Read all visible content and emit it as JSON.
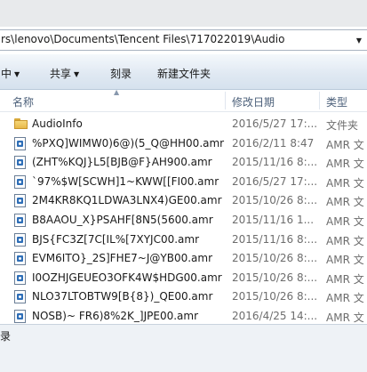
{
  "address": {
    "path": "rs\\lenovo\\Documents\\Tencent Files\\717022019\\Audio",
    "dropdown_icon": "chevron-down-icon"
  },
  "toolbar": {
    "organize_fragment": "中",
    "share_label": "共享",
    "burn_label": "刻录",
    "new_folder_label": "新建文件夹"
  },
  "columns": {
    "name": "名称",
    "date": "修改日期",
    "type": "类型"
  },
  "files": [
    {
      "name": "AudioInfo",
      "date": "2016/5/27 17:...",
      "type": "文件夹",
      "icon": "folder-icon"
    },
    {
      "name": "%PXQ]WIMW0)6@)(5_Q@HH00.amr",
      "date": "2016/2/11 8:47",
      "type": "AMR 文",
      "icon": "audio-file-icon"
    },
    {
      "name": "(ZHT%KQJ}L5[BJB@F}AH900.amr",
      "date": "2015/11/16 8:...",
      "type": "AMR 文",
      "icon": "audio-file-icon"
    },
    {
      "name": "`97%$W[SCWH]1~KWW[[FI00.amr",
      "date": "2016/5/27 17:...",
      "type": "AMR 文",
      "icon": "audio-file-icon"
    },
    {
      "name": "2M4KR8KQ1LDWA3LNX4)GE00.amr",
      "date": "2015/10/26 8:...",
      "type": "AMR 文",
      "icon": "audio-file-icon"
    },
    {
      "name": "B8AAOU_X}PSAHF[8N5(5600.amr",
      "date": "2015/11/16 1...",
      "type": "AMR 文",
      "icon": "audio-file-icon"
    },
    {
      "name": "BJS{FC3Z[7C[IL%[7XYJC00.amr",
      "date": "2015/11/16 8:...",
      "type": "AMR 文",
      "icon": "audio-file-icon"
    },
    {
      "name": "EVM6ITO}_2S]FHE7~J@YB00.amr",
      "date": "2015/10/26 8:...",
      "type": "AMR 文",
      "icon": "audio-file-icon"
    },
    {
      "name": "I0OZHJGEUEO3OFK4W$HDG00.amr",
      "date": "2015/10/26 8:...",
      "type": "AMR 文",
      "icon": "audio-file-icon"
    },
    {
      "name": "NLO37LTOBTW9[B{8})_QE00.amr",
      "date": "2015/10/26 8:...",
      "type": "AMR 文",
      "icon": "audio-file-icon"
    },
    {
      "name": "NOSB)~ FR6)8%2K_]JPE00.amr",
      "date": "2016/4/25 14:...",
      "type": "AMR 文",
      "icon": "audio-file-icon"
    }
  ],
  "status": {
    "text": "录"
  }
}
